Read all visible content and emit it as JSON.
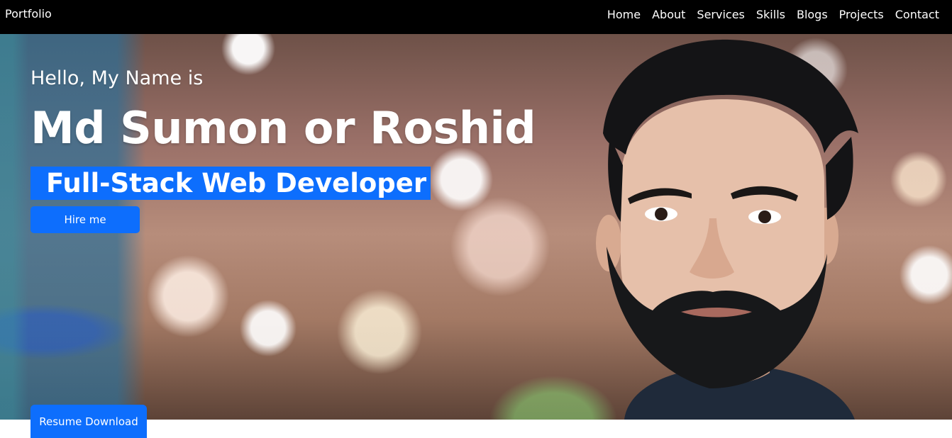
{
  "navbar": {
    "brand": "Portfolio",
    "links": [
      "Home",
      "About",
      "Services",
      "Skills",
      "Blogs",
      "Projects",
      "Contact"
    ]
  },
  "hero": {
    "greeting": "Hello, My Name is",
    "name": "Md Sumon or Roshid",
    "role": "Full-Stack Web Developer",
    "hire_button": "Hire me",
    "resume_button": "Resume Download"
  },
  "colors": {
    "navbar_bg": "#000000",
    "accent": "#0d6efd",
    "text": "#ffffff"
  }
}
